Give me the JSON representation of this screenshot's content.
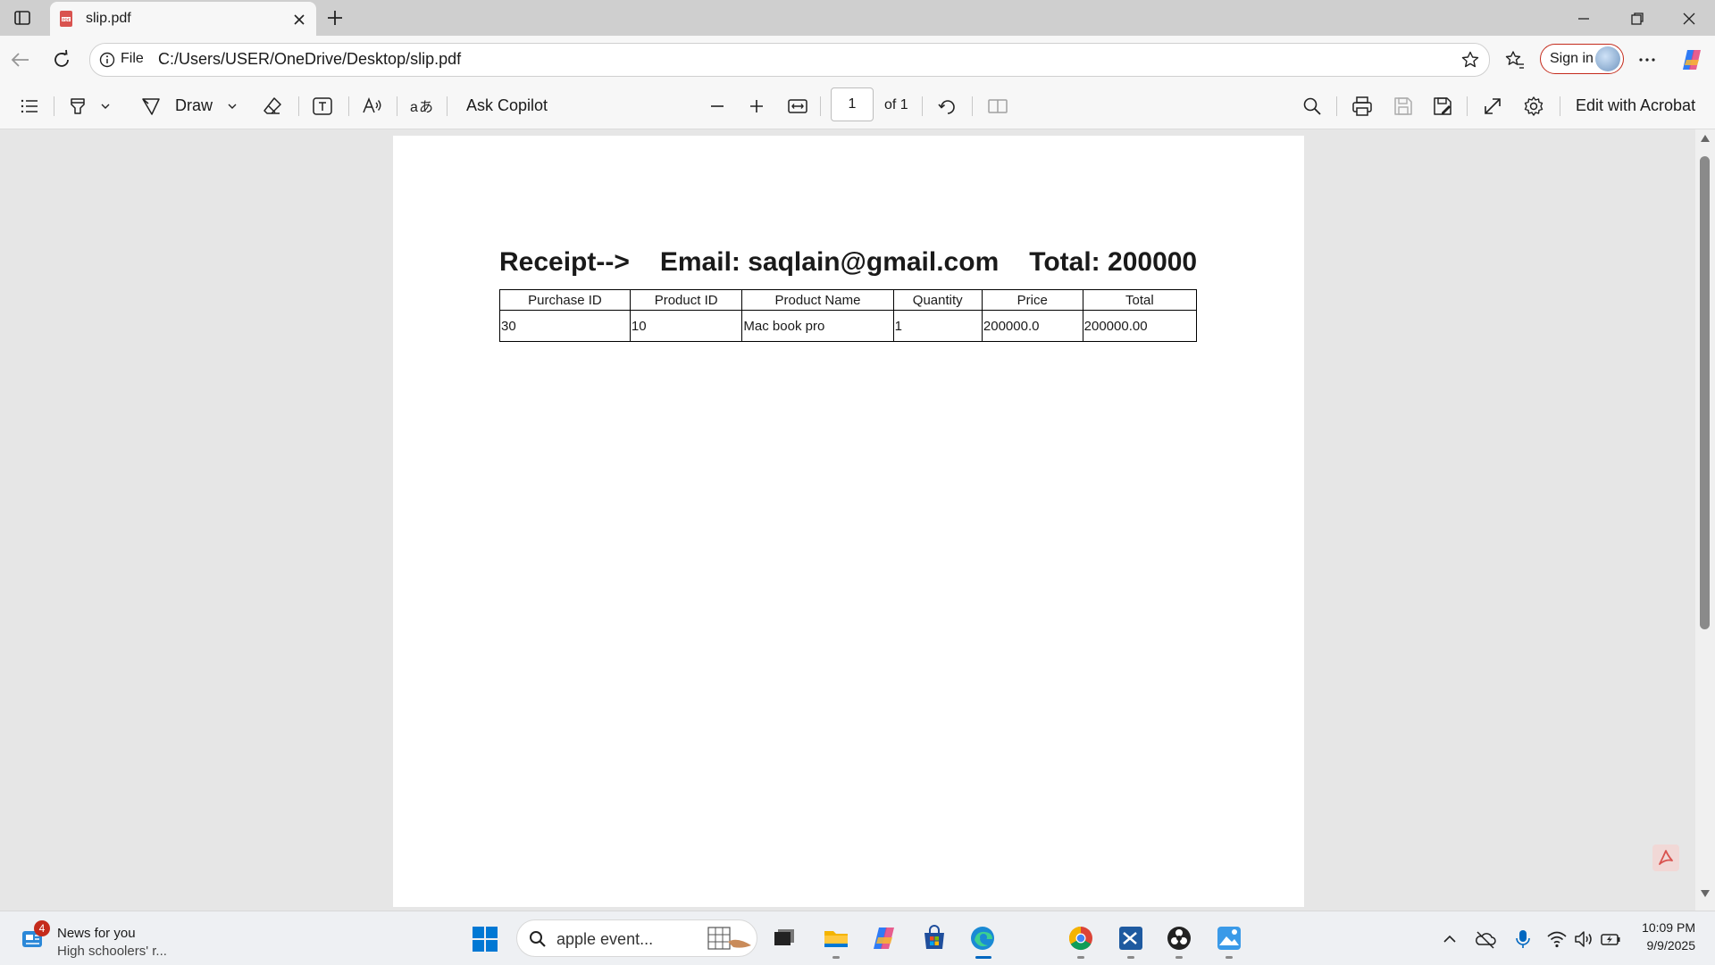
{
  "browser": {
    "tab": {
      "title": "slip.pdf"
    },
    "address": {
      "scheme_label": "File",
      "url": "C:/Users/USER/OneDrive/Desktop/slip.pdf"
    },
    "signin_label": "Sign in"
  },
  "pdf_toolbar": {
    "draw_label": "Draw",
    "ask_copilot_label": "Ask Copilot",
    "page_current": "1",
    "page_of": "of 1",
    "edit_acrobat_label": "Edit with Acrobat"
  },
  "document": {
    "heading": {
      "receipt": "Receipt-->",
      "email": "Email: saqlain@gmail.com",
      "total": "Total: 200000"
    },
    "columns": [
      "Purchase ID",
      "Product ID",
      "Product Name",
      "Quantity",
      "Price",
      "Total"
    ],
    "rows": [
      [
        "30",
        "10",
        "Mac book pro",
        "1",
        "200000.0",
        "200000.00"
      ]
    ]
  },
  "taskbar": {
    "news": {
      "badge": "4",
      "title": "News for you",
      "subtitle": "High schoolers' r..."
    },
    "search_text": "apple event...",
    "clock": {
      "time": "10:09 PM",
      "date": "9/9/2025"
    }
  },
  "colors": {
    "accent": "#0067c0",
    "signin_border": "#c42b1c",
    "pdf_icon": "#d9534f"
  }
}
